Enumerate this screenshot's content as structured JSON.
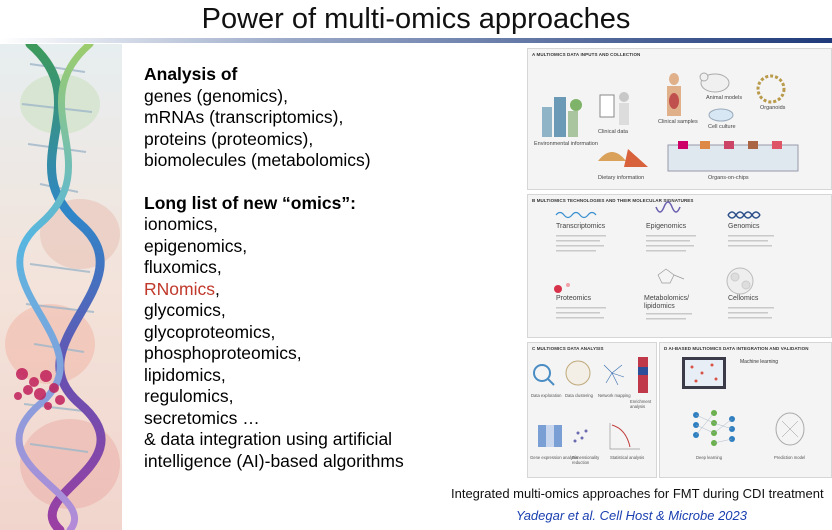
{
  "slide": {
    "title": "Power of multi-omics approaches"
  },
  "analysis": {
    "heading": "Analysis of",
    "items": [
      "genes (genomics),",
      "mRNAs (transcriptomics),",
      "proteins (proteomics),",
      "biomolecules (metabolomics)"
    ]
  },
  "omics": {
    "heading": "Long list of new “omics”:",
    "items": [
      "ionomics,",
      "epigenomics,",
      "fluxomics,",
      "RNomics,",
      "glycomics,",
      "glycoproteomics,",
      "phosphoproteomics,",
      "lipidomics,",
      "regulomics,",
      "secretomics …",
      "& data integration using artificial",
      "intelligence (AI)-based algorithms"
    ],
    "highlight_color": "#c0392b"
  },
  "figure": {
    "panel_a": {
      "label": "A   MULTIOMICS DATA INPUTS AND COLLECTION",
      "items": [
        "Environmental information",
        "Clinical data",
        "Clinical samples",
        "Animal models",
        "Cell culture",
        "Organoids",
        "Dietary information",
        "Organs-on-chips"
      ]
    },
    "panel_b": {
      "label": "B   MULTIOMICS TECHNOLOGIES AND THEIR MOLECULAR SIGNATURES",
      "items": [
        "Transcriptomics",
        "Epigenomics",
        "Genomics",
        "Proteomics",
        "Metabolomics/ lipidomics",
        "Cellomics"
      ]
    },
    "panel_c": {
      "label": "C   MULTIOMICS DATA ANALYSIS",
      "items": [
        "Data exploration",
        "Data clustering",
        "Network mapping",
        "Enrichment analysis",
        "Gene expression analysis",
        "Dimensionality reduction",
        "Statistical analysis"
      ]
    },
    "panel_d": {
      "label": "D   AI-BASED MULTIOMICS DATA INTEGRATION AND VALIDATION",
      "items": [
        "Machine learning",
        "Deep learning",
        "Prediction model"
      ]
    }
  },
  "caption": "Integrated multi-omics approaches for FMT during CDI treatment",
  "citation": "Yadegar et al. Cell Host & Microbe 2023",
  "colors": {
    "title_bar": "#1f3a7a",
    "citation": "#1a3fb0"
  }
}
